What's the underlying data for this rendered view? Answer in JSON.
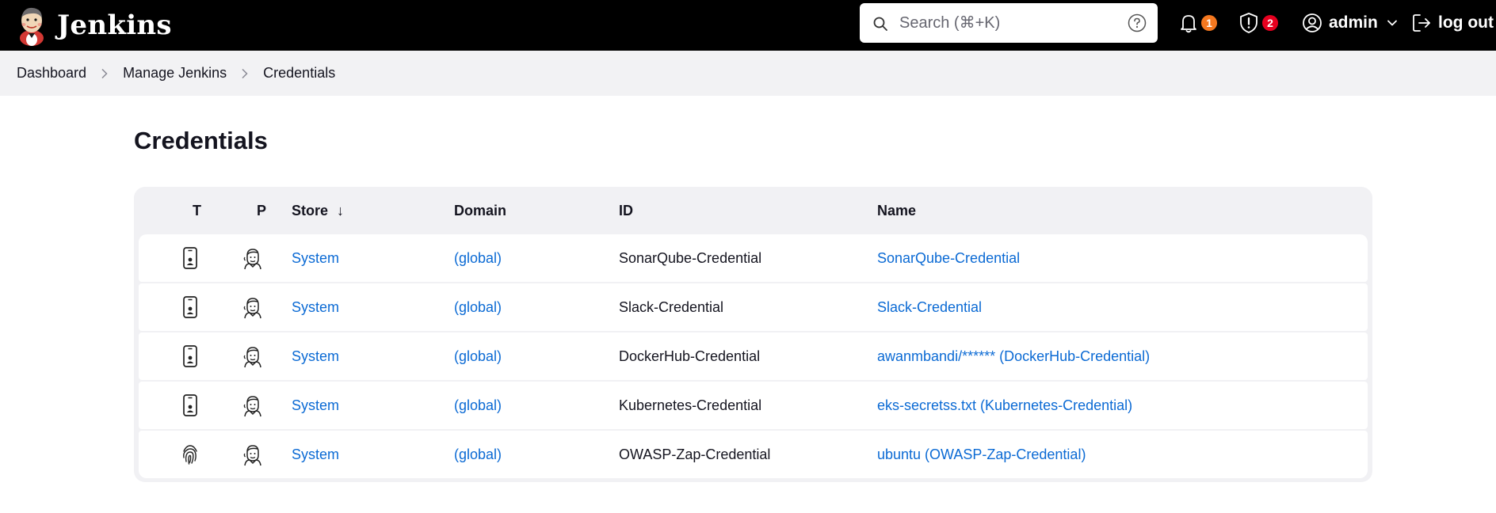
{
  "header": {
    "brand": "Jenkins",
    "search_placeholder": "Search (⌘+K)",
    "notifications_count": "1",
    "security_count": "2",
    "user": "admin",
    "logout": "log out"
  },
  "breadcrumb": {
    "items": [
      "Dashboard",
      "Manage Jenkins",
      "Credentials"
    ]
  },
  "page": {
    "title": "Credentials"
  },
  "table": {
    "columns": [
      "T",
      "P",
      "Store",
      "Domain",
      "ID",
      "Name"
    ],
    "sort_indicator": "↓",
    "rows": [
      {
        "type_icon": "mobile-credential-icon",
        "provider_icon": "jenkins-butler-icon",
        "store": "System",
        "domain": "(global)",
        "id": "SonarQube-Credential",
        "name": "SonarQube-Credential"
      },
      {
        "type_icon": "mobile-credential-icon",
        "provider_icon": "jenkins-butler-icon",
        "store": "System",
        "domain": "(global)",
        "id": "Slack-Credential",
        "name": "Slack-Credential"
      },
      {
        "type_icon": "mobile-credential-icon",
        "provider_icon": "jenkins-butler-icon",
        "store": "System",
        "domain": "(global)",
        "id": "DockerHub-Credential",
        "name": "awanmbandi/****** (DockerHub-Credential)"
      },
      {
        "type_icon": "mobile-credential-icon",
        "provider_icon": "jenkins-butler-icon",
        "store": "System",
        "domain": "(global)",
        "id": "Kubernetes-Credential",
        "name": "eks-secretss.txt (Kubernetes-Credential)"
      },
      {
        "type_icon": "fingerprint-icon",
        "provider_icon": "jenkins-butler-icon",
        "store": "System",
        "domain": "(global)",
        "id": "OWASP-Zap-Credential",
        "name": "ubuntu (OWASP-Zap-Credential)"
      }
    ]
  },
  "colors": {
    "header_bg": "#000000",
    "link": "#0b6ad4",
    "breadcrumb_bg": "#f2f2f4",
    "notification_badge": "#f5781f",
    "security_badge": "#e6001f"
  }
}
